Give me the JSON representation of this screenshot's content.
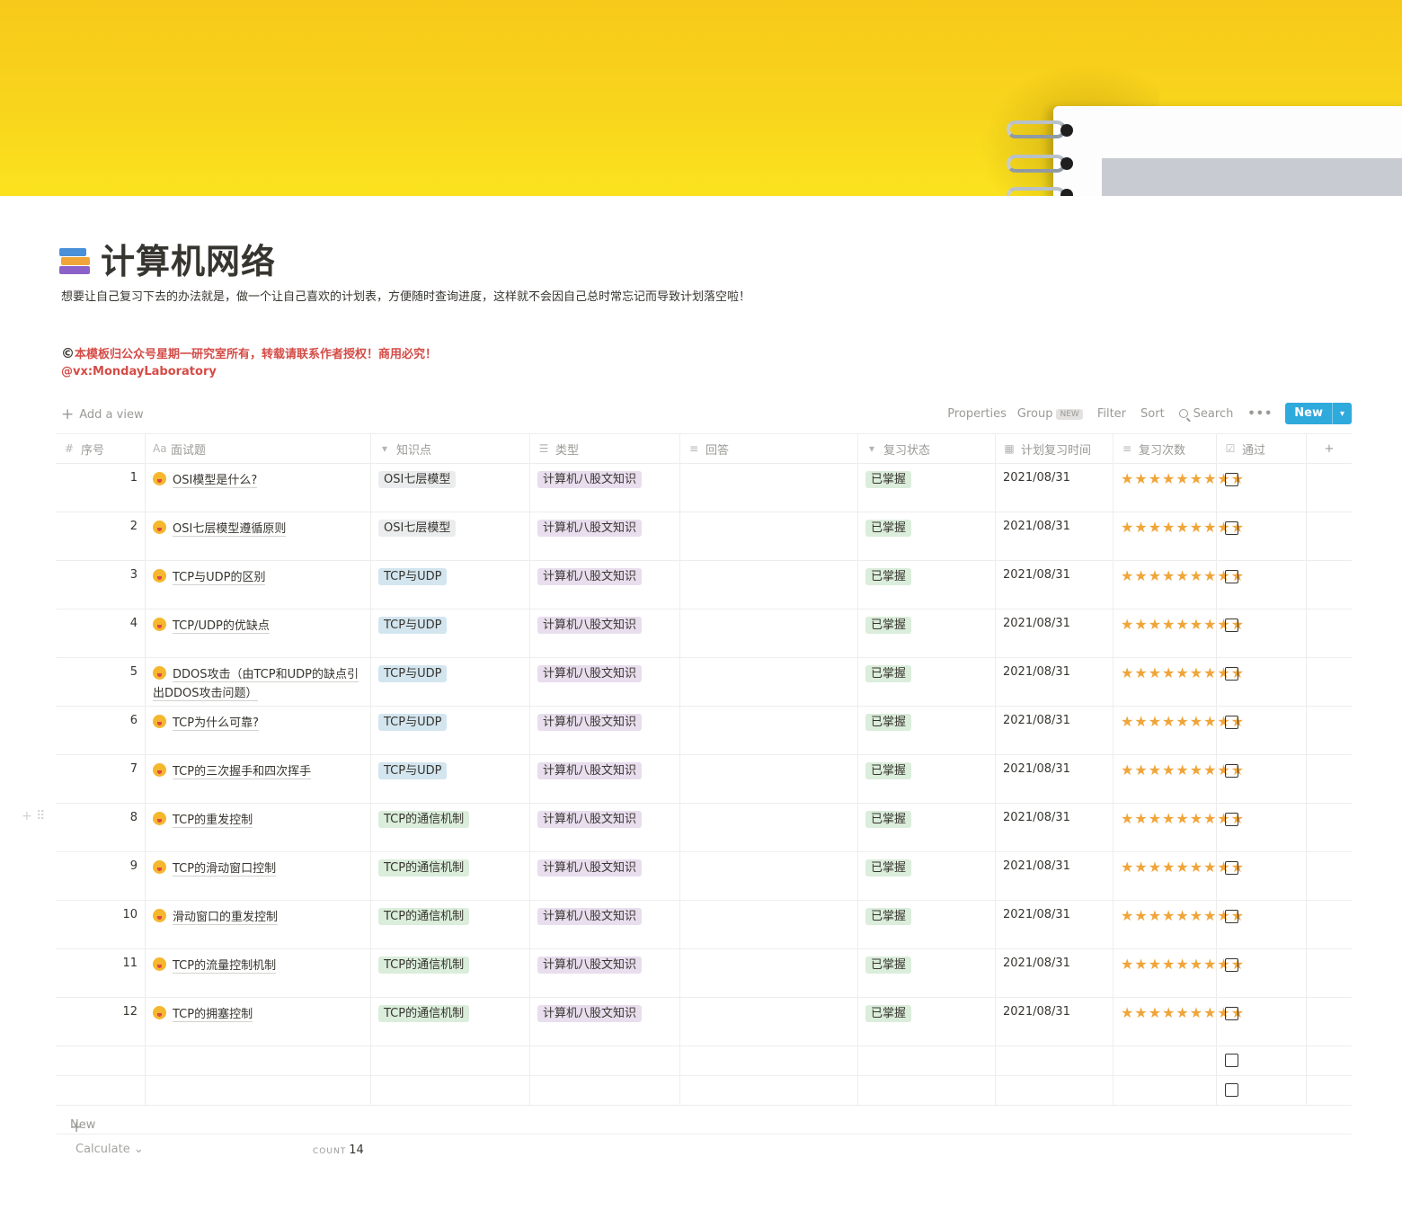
{
  "page": {
    "title": "计算机网络",
    "description": "想要让自己复习下去的办法就是，做一个让自己喜欢的计划表，方便随时查询进度，这样就不会因自己总时常忘记而导致计划落空啦！",
    "copyright_symbol": "©",
    "notice": "本模板归公众号星期一研究室所有，转载请联系作者授权！商用必究！",
    "contact": "@vx:MondayLaboratory",
    "icon": "books-icon"
  },
  "toolbar": {
    "add_view": "Add a view",
    "properties": "Properties",
    "group": "Group",
    "group_badge": "NEW",
    "filter": "Filter",
    "sort": "Sort",
    "search": "Search",
    "more": "•••",
    "new": "New"
  },
  "columns": [
    {
      "label": "序号",
      "icon": "#"
    },
    {
      "label": "面试题",
      "icon": "Aa"
    },
    {
      "label": "知识点",
      "icon": "▾"
    },
    {
      "label": "类型",
      "icon": "☰"
    },
    {
      "label": "回答",
      "icon": "≡"
    },
    {
      "label": "复习状态",
      "icon": "▾"
    },
    {
      "label": "计划复习时间",
      "icon": "▦"
    },
    {
      "label": "复习次数",
      "icon": "≡"
    },
    {
      "label": "通过",
      "icon": "☑"
    }
  ],
  "tag_colors": {
    "OSI七层模型": {
      "bg": "#ebeced",
      "fg": "#37352f"
    },
    "TCP与UDP": {
      "bg": "#d3e5ef",
      "fg": "#37352f"
    },
    "TCP的通信机制": {
      "bg": "#dbeddb",
      "fg": "#37352f"
    },
    "计算机八股文知识": {
      "bg": "#e8deee",
      "fg": "#37352f"
    },
    "已掌握": {
      "bg": "#dbeddb",
      "fg": "#37352f"
    }
  },
  "rows": [
    {
      "num": "1",
      "question": "OSI模型是什么?",
      "knowledge": "OSI七层模型",
      "type": "计算机八股文知识",
      "answer": "",
      "status": "已掌握",
      "date": "2021/08/31",
      "reviews": "★★★★★★★★★"
    },
    {
      "num": "2",
      "question": "OSI七层模型遵循原则",
      "knowledge": "OSI七层模型",
      "type": "计算机八股文知识",
      "answer": "",
      "status": "已掌握",
      "date": "2021/08/31",
      "reviews": "★★★★★★★★★"
    },
    {
      "num": "3",
      "question": "TCP与UDP的区别",
      "knowledge": "TCP与UDP",
      "type": "计算机八股文知识",
      "answer": "",
      "status": "已掌握",
      "date": "2021/08/31",
      "reviews": "★★★★★★★★★"
    },
    {
      "num": "4",
      "question": "TCP/UDP的优缺点",
      "knowledge": "TCP与UDP",
      "type": "计算机八股文知识",
      "answer": "",
      "status": "已掌握",
      "date": "2021/08/31",
      "reviews": "★★★★★★★★★"
    },
    {
      "num": "5",
      "question": "DDOS攻击（由TCP和UDP的缺点引出DDOS攻击问题）",
      "knowledge": "TCP与UDP",
      "type": "计算机八股文知识",
      "answer": "",
      "status": "已掌握",
      "date": "2021/08/31",
      "reviews": "★★★★★★★★★"
    },
    {
      "num": "6",
      "question": "TCP为什么可靠?",
      "knowledge": "TCP与UDP",
      "type": "计算机八股文知识",
      "answer": "",
      "status": "已掌握",
      "date": "2021/08/31",
      "reviews": "★★★★★★★★★"
    },
    {
      "num": "7",
      "question": "TCP的三次握手和四次挥手",
      "knowledge": "TCP与UDP",
      "type": "计算机八股文知识",
      "answer": "",
      "status": "已掌握",
      "date": "2021/08/31",
      "reviews": "★★★★★★★★★"
    },
    {
      "num": "8",
      "question": "TCP的重发控制",
      "knowledge": "TCP的通信机制",
      "type": "计算机八股文知识",
      "answer": "",
      "status": "已掌握",
      "date": "2021/08/31",
      "reviews": "★★★★★★★★★"
    },
    {
      "num": "9",
      "question": "TCP的滑动窗口控制",
      "knowledge": "TCP的通信机制",
      "type": "计算机八股文知识",
      "answer": "",
      "status": "已掌握",
      "date": "2021/08/31",
      "reviews": "★★★★★★★★★"
    },
    {
      "num": "10",
      "question": "滑动窗口的重发控制",
      "knowledge": "TCP的通信机制",
      "type": "计算机八股文知识",
      "answer": "",
      "status": "已掌握",
      "date": "2021/08/31",
      "reviews": "★★★★★★★★★"
    },
    {
      "num": "11",
      "question": "TCP的流量控制机制",
      "knowledge": "TCP的通信机制",
      "type": "计算机八股文知识",
      "answer": "",
      "status": "已掌握",
      "date": "2021/08/31",
      "reviews": "★★★★★★★★★"
    },
    {
      "num": "12",
      "question": "TCP的拥塞控制",
      "knowledge": "TCP的通信机制",
      "type": "计算机八股文知识",
      "answer": "",
      "status": "已掌握",
      "date": "2021/08/31",
      "reviews": "★★★★★★★★★"
    }
  ],
  "empty_rows": 2,
  "footer": {
    "new": "New",
    "calculate": "Calculate ⌄",
    "count_label": "COUNT",
    "count_value": "14"
  }
}
